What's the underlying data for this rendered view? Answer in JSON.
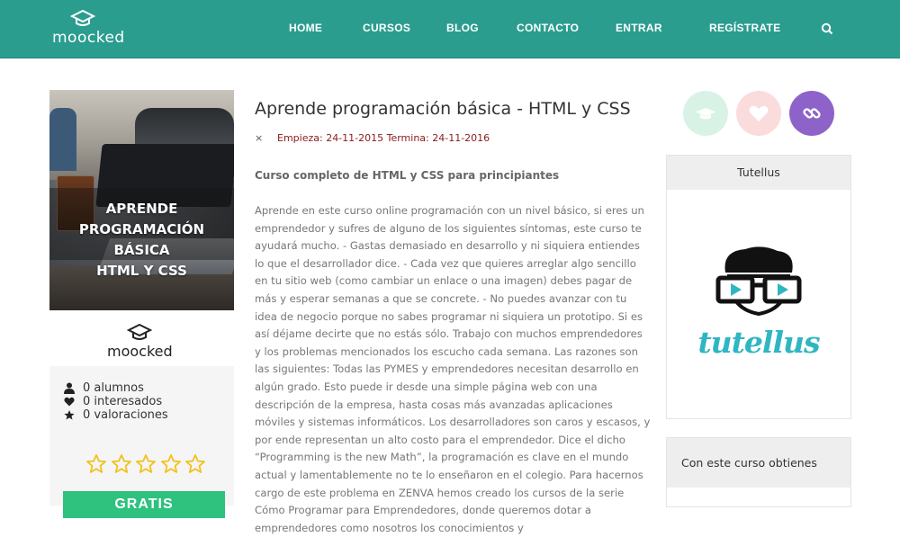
{
  "header": {
    "brand": "moocked",
    "nav": [
      "HOME",
      "CURSOS",
      "BLOG",
      "CONTACTO",
      "ENTRAR",
      "REGÍSTRATE"
    ],
    "search_icon": "search-icon",
    "bg_color": "#2a9d8f"
  },
  "course": {
    "card_title_lines": [
      "APRENDE",
      "PROGRAMACIÓN BÁSICA",
      "HTML Y CSS"
    ],
    "provider": "moocked",
    "title": "Aprende programación básica - HTML y CSS",
    "dates": "Empieza: 24-11-2015 Termina: 24-11-2016",
    "dates_close": "×",
    "subtitle": "Curso completo de HTML y CSS para principiantes",
    "description": "Aprende en este curso online programación con un nivel básico, si eres un emprendedor y sufres de alguno de los siguientes síntomas, este curso te ayudará mucho. - Gastas demasiado en desarrollo y ni siquiera entiendes lo que el desarrollador dice. - Cada vez que quieres arreglar algo sencillo en tu sitio web (como cambiar un enlace o una imagen) debes pagar de más y esperar semanas a que se concrete. - No puedes avanzar con tu idea de negocio porque no sabes programar ni siquiera un prototipo. Si es así déjame decirte que no estás sólo. Trabajo con muchos emprendedores y los problemas mencionados los escucho cada semana. Las razones son las siguientes: Todas las PYMES y emprendedores necesitan desarrollo en algún grado. Esto puede ir desde una simple página web con una descripción de la empresa, hasta cosas más avanzadas aplicaciones móviles y sistemas informáticos. Los desarrolladores son caros y escasos, y por ende representan un alto costo para el emprendedor. Dice el dicho “Programming is the new Math”, la programación es clave en el mundo actual y lamentablemente no te lo enseñaron en el colegio. Para hacernos cargo de este problema en ZENVA hemos creado los cursos de la serie Cómo Programar para Emprendedores, donde queremos dotar a emprendedores como nosotros los conocimientos y"
  },
  "stats": {
    "students": "0 alumnos",
    "interested": "0 interesados",
    "ratings": "0 valoraciones",
    "rating_value": 0,
    "rating_max": 5
  },
  "cta": {
    "label": "GRATIS",
    "color": "#2ec27e"
  },
  "actions": [
    {
      "name": "graduation-cap-icon",
      "color": "#d8f2e6"
    },
    {
      "name": "heart-icon",
      "color": "#fbdcdc"
    },
    {
      "name": "link-icon",
      "color": "#8e63c9"
    }
  ],
  "sidebar": {
    "provider_box_title": "Tutellus",
    "provider_word": "tutellus",
    "benefits_title": "Con este curso obtienes"
  }
}
